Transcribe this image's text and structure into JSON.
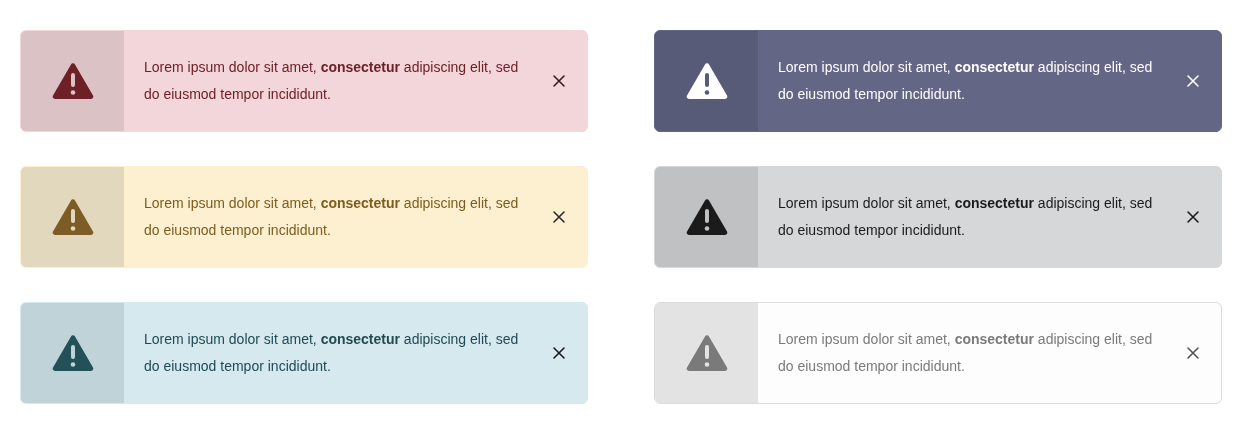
{
  "alerts": [
    {
      "kind": "danger",
      "message": "Lorem ipsum dolor sit amet, **consectetur** adipiscing elit, sed do eiusmod tempor incididunt."
    },
    {
      "kind": "primary",
      "message": "Lorem ipsum dolor sit amet, **consectetur** adipiscing elit, sed do eiusmod tempor incididunt."
    },
    {
      "kind": "warning",
      "message": "Lorem ipsum dolor sit amet, **consectetur** adipiscing elit, sed do eiusmod tempor incididunt."
    },
    {
      "kind": "secondary",
      "message": "Lorem ipsum dolor sit amet, **consectetur** adipiscing elit, sed do eiusmod tempor incididunt."
    },
    {
      "kind": "info",
      "message": "Lorem ipsum dolor sit amet, **consectetur** adipiscing elit, sed do eiusmod tempor incididunt."
    },
    {
      "kind": "light",
      "message": "Lorem ipsum dolor sit amet, **consectetur** adipiscing elit, sed do eiusmod tempor incididunt."
    }
  ]
}
